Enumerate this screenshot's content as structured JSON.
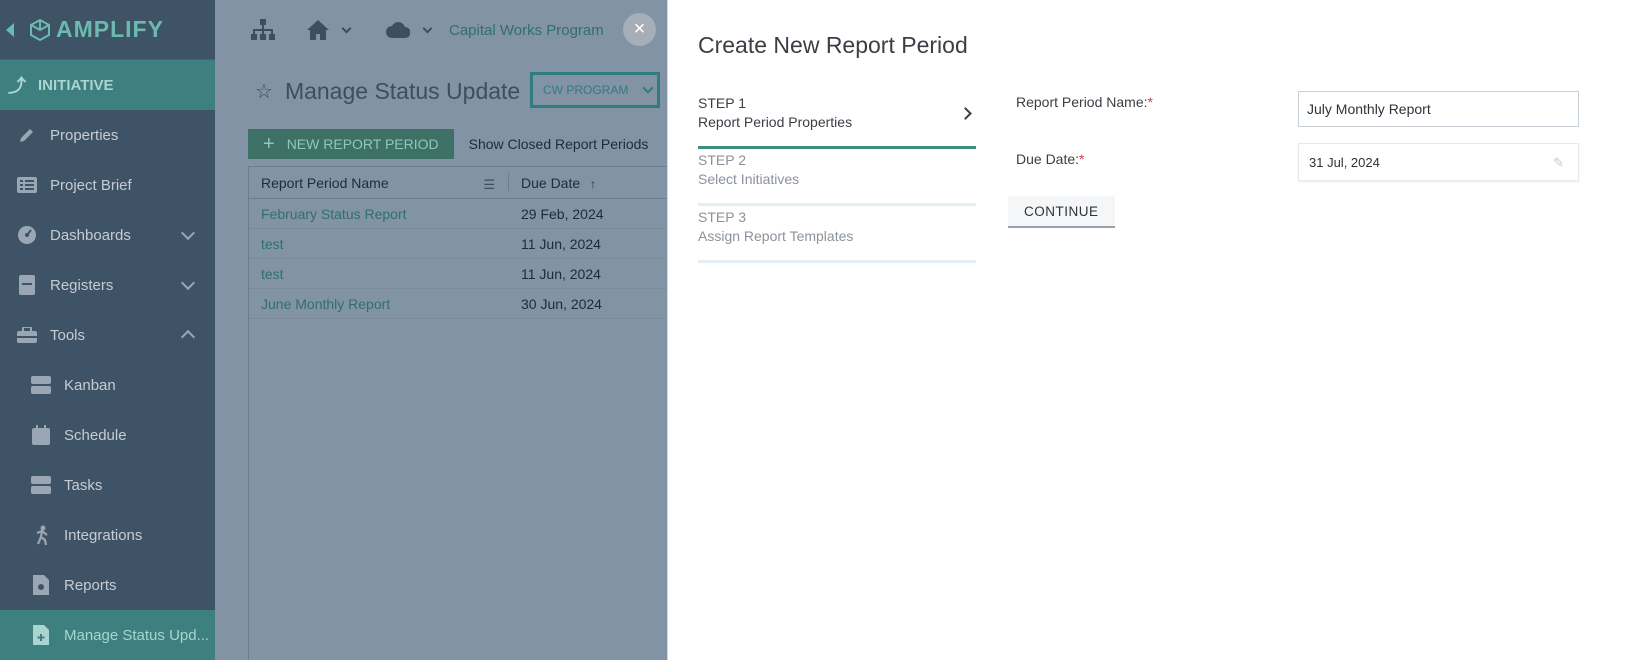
{
  "sidebar": {
    "brand": "AMPLIFY",
    "section": "INITIATIVE",
    "items": [
      {
        "label": "Properties"
      },
      {
        "label": "Project Brief"
      },
      {
        "label": "Dashboards"
      },
      {
        "label": "Registers"
      },
      {
        "label": "Tools"
      },
      {
        "label": "Kanban"
      },
      {
        "label": "Schedule"
      },
      {
        "label": "Tasks"
      },
      {
        "label": "Integrations"
      },
      {
        "label": "Reports"
      },
      {
        "label": "Manage Status Upd..."
      }
    ]
  },
  "topbar": {
    "breadcrumb": "Capital Works Program",
    "close_label": "×"
  },
  "page": {
    "title": "Manage Status Update",
    "program_dropdown": "CW PROGRAM",
    "new_button": "NEW REPORT PERIOD",
    "closed_link": "Show Closed Report Periods"
  },
  "grid": {
    "columns": [
      "Report Period Name",
      "Due Date"
    ],
    "sort_indicator": "↑",
    "rows": [
      {
        "name": "February Status Report",
        "due": "29 Feb, 2024"
      },
      {
        "name": "test",
        "due": "11 Jun, 2024"
      },
      {
        "name": "test",
        "due": "11 Jun, 2024"
      },
      {
        "name": "June Monthly Report",
        "due": "30 Jun, 2024"
      }
    ]
  },
  "modal": {
    "title": "Create New Report Period",
    "steps": [
      {
        "num": "STEP 1",
        "name": "Report Period Properties",
        "active": true
      },
      {
        "num": "STEP 2",
        "name": "Select Initiatives",
        "active": false
      },
      {
        "num": "STEP 3",
        "name": "Assign Report Templates",
        "active": false
      }
    ],
    "name_label": "Report Period Name:",
    "name_value": "July Monthly Report",
    "due_label": "Due Date:",
    "due_value": "31 Jul, 2024",
    "required_mark": "*",
    "continue_label": "CONTINUE"
  },
  "colors": {
    "sidebar_bg": "#3f5366",
    "accent_teal": "#3e8f80",
    "required": "#d13a4a"
  }
}
